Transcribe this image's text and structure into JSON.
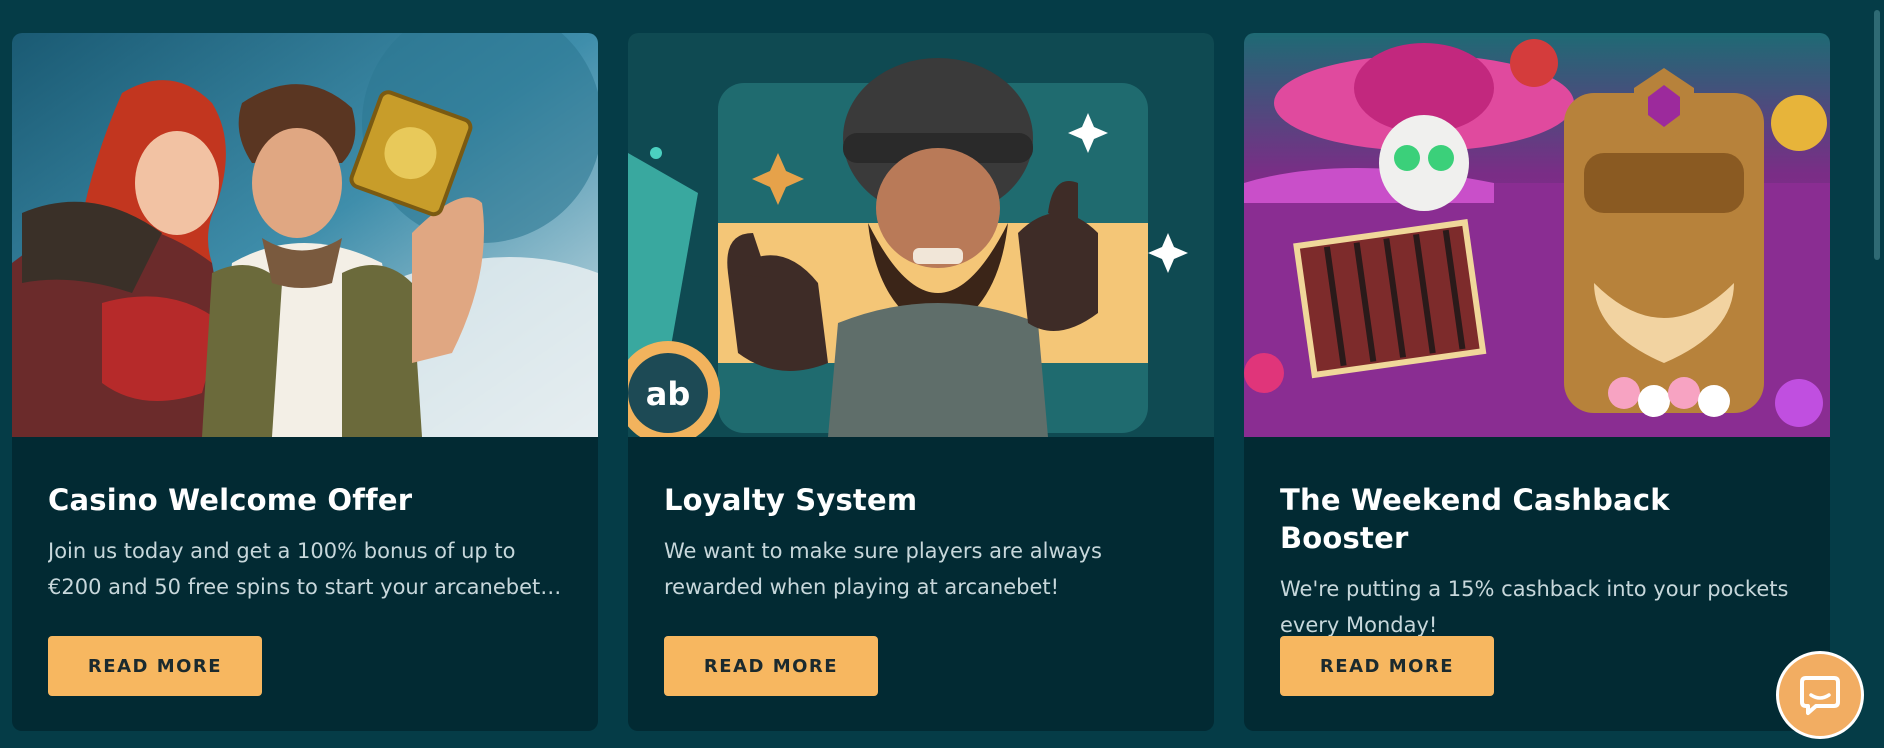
{
  "colors": {
    "page_background": "#053c47",
    "card_background": "#022a33",
    "button_background": "#f7b760",
    "button_text": "#1b2a2e",
    "title_text": "#ffffff",
    "desc_text": "#c7d7db",
    "chat_button": "#f2ad62"
  },
  "cards": [
    {
      "title": "Casino Welcome Offer",
      "description": "Join us today and get a 100% bonus of up to €200 and 50 free spins to start your arcanebet experience!",
      "button_label": "READ MORE",
      "image": "adventurer-and-woman-illustration"
    },
    {
      "title": "Loyalty System",
      "description": "We want to make sure players are always rewarded when playing at arcanebet!",
      "button_label": "READ MORE",
      "image": "bearded-conquistador-thumbs-up-illustration",
      "badge_text": "ab"
    },
    {
      "title": "The Weekend Cashback Booster",
      "description": "We're putting a 15% cashback into your pockets every Monday!",
      "button_label": "READ MORE",
      "image": "skeleton-mariachi-and-tiki-mask-illustration"
    }
  ],
  "chat": {
    "icon": "chat-bubble-icon"
  }
}
